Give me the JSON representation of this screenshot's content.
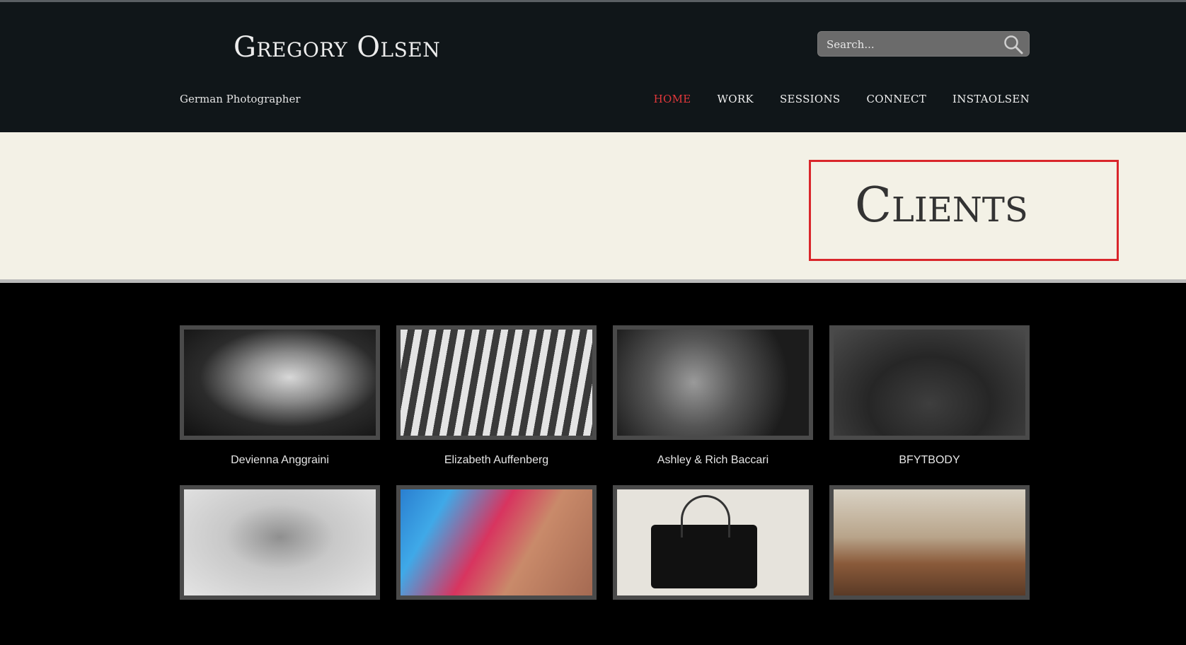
{
  "site": {
    "title": "Gregory Olsen",
    "tagline": "German Photographer"
  },
  "search": {
    "placeholder": "Search..."
  },
  "nav": {
    "items": [
      {
        "label": "HOME",
        "active": true
      },
      {
        "label": "WORK",
        "active": false
      },
      {
        "label": "SESSIONS",
        "active": false
      },
      {
        "label": "CONNECT",
        "active": false
      },
      {
        "label": "INSTAOLSEN",
        "active": false
      }
    ]
  },
  "hero": {
    "title": "Clients"
  },
  "clients": [
    {
      "name": "Devienna Anggraini"
    },
    {
      "name": "Elizabeth Auffenberg"
    },
    {
      "name": "Ashley & Rich Baccari"
    },
    {
      "name": "BFYTBODY"
    },
    {
      "name": ""
    },
    {
      "name": ""
    },
    {
      "name": ""
    },
    {
      "name": ""
    }
  ],
  "colors": {
    "header_bg": "#101619",
    "hero_bg": "#f3f1e6",
    "accent": "#e2383b",
    "highlight_border": "#d9262b"
  }
}
